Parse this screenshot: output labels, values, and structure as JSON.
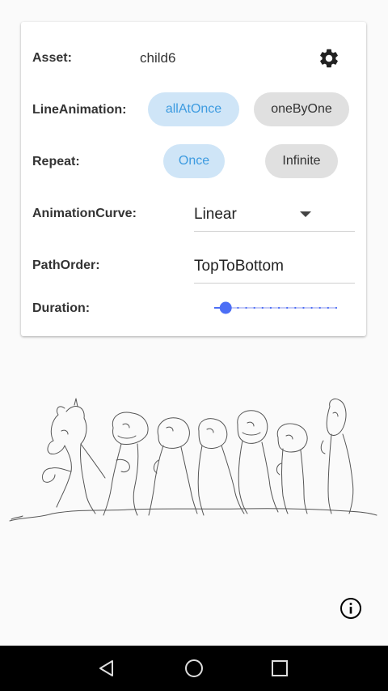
{
  "settings": {
    "asset": {
      "label": "Asset:",
      "value": "child6"
    },
    "line_animation": {
      "label": "LineAnimation:",
      "options": [
        "allAtOnce",
        "oneByOne"
      ],
      "selected": "allAtOnce"
    },
    "repeat": {
      "label": "Repeat:",
      "options": [
        "Once",
        "Infinite"
      ],
      "selected": "Once"
    },
    "animation_curve": {
      "label": "AnimationCurve:",
      "value": "Linear"
    },
    "path_order": {
      "label": "PathOrder:",
      "value": "TopToBottom"
    },
    "duration": {
      "label": "Duration:",
      "level": 0.1,
      "steps": 15
    }
  },
  "icons": {
    "settings": "gear-icon",
    "dropdown": "arrow-drop-down-icon",
    "info": "info-icon",
    "nav_back": "triangle-back-icon",
    "nav_home": "circle-home-icon",
    "nav_recents": "square-recents-icon"
  },
  "colors": {
    "accent": "#3d9be0",
    "chip_selected_bg": "#cfe5f7",
    "chip_unselected_bg": "#e0e0e0",
    "slider_active": "#4c6ef5",
    "slider_inactive": "#c5cbf6",
    "navbar": "#000000"
  }
}
